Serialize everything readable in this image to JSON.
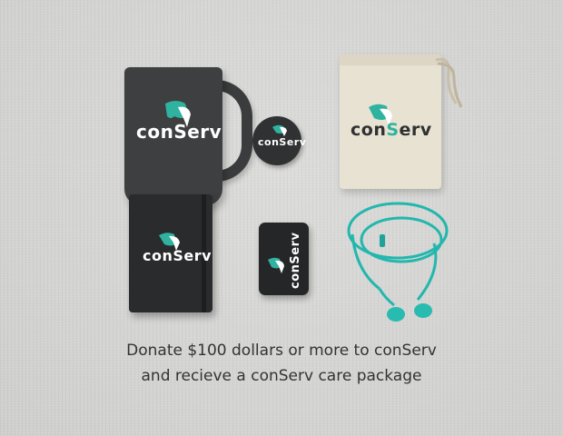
{
  "brand": {
    "prefix": "con",
    "accent": "S",
    "suffix": "erv",
    "accent_color": "#2fb3a0"
  },
  "products": {
    "mug_brand": "conServ",
    "badge_brand": "conServ",
    "pouch_brand": "conServ",
    "notebook_brand": "conServ",
    "phone_brand": "conServ"
  },
  "caption": {
    "line1": "Donate $100 dollars or more to conServ",
    "line2": "and recieve a conServ care package"
  }
}
